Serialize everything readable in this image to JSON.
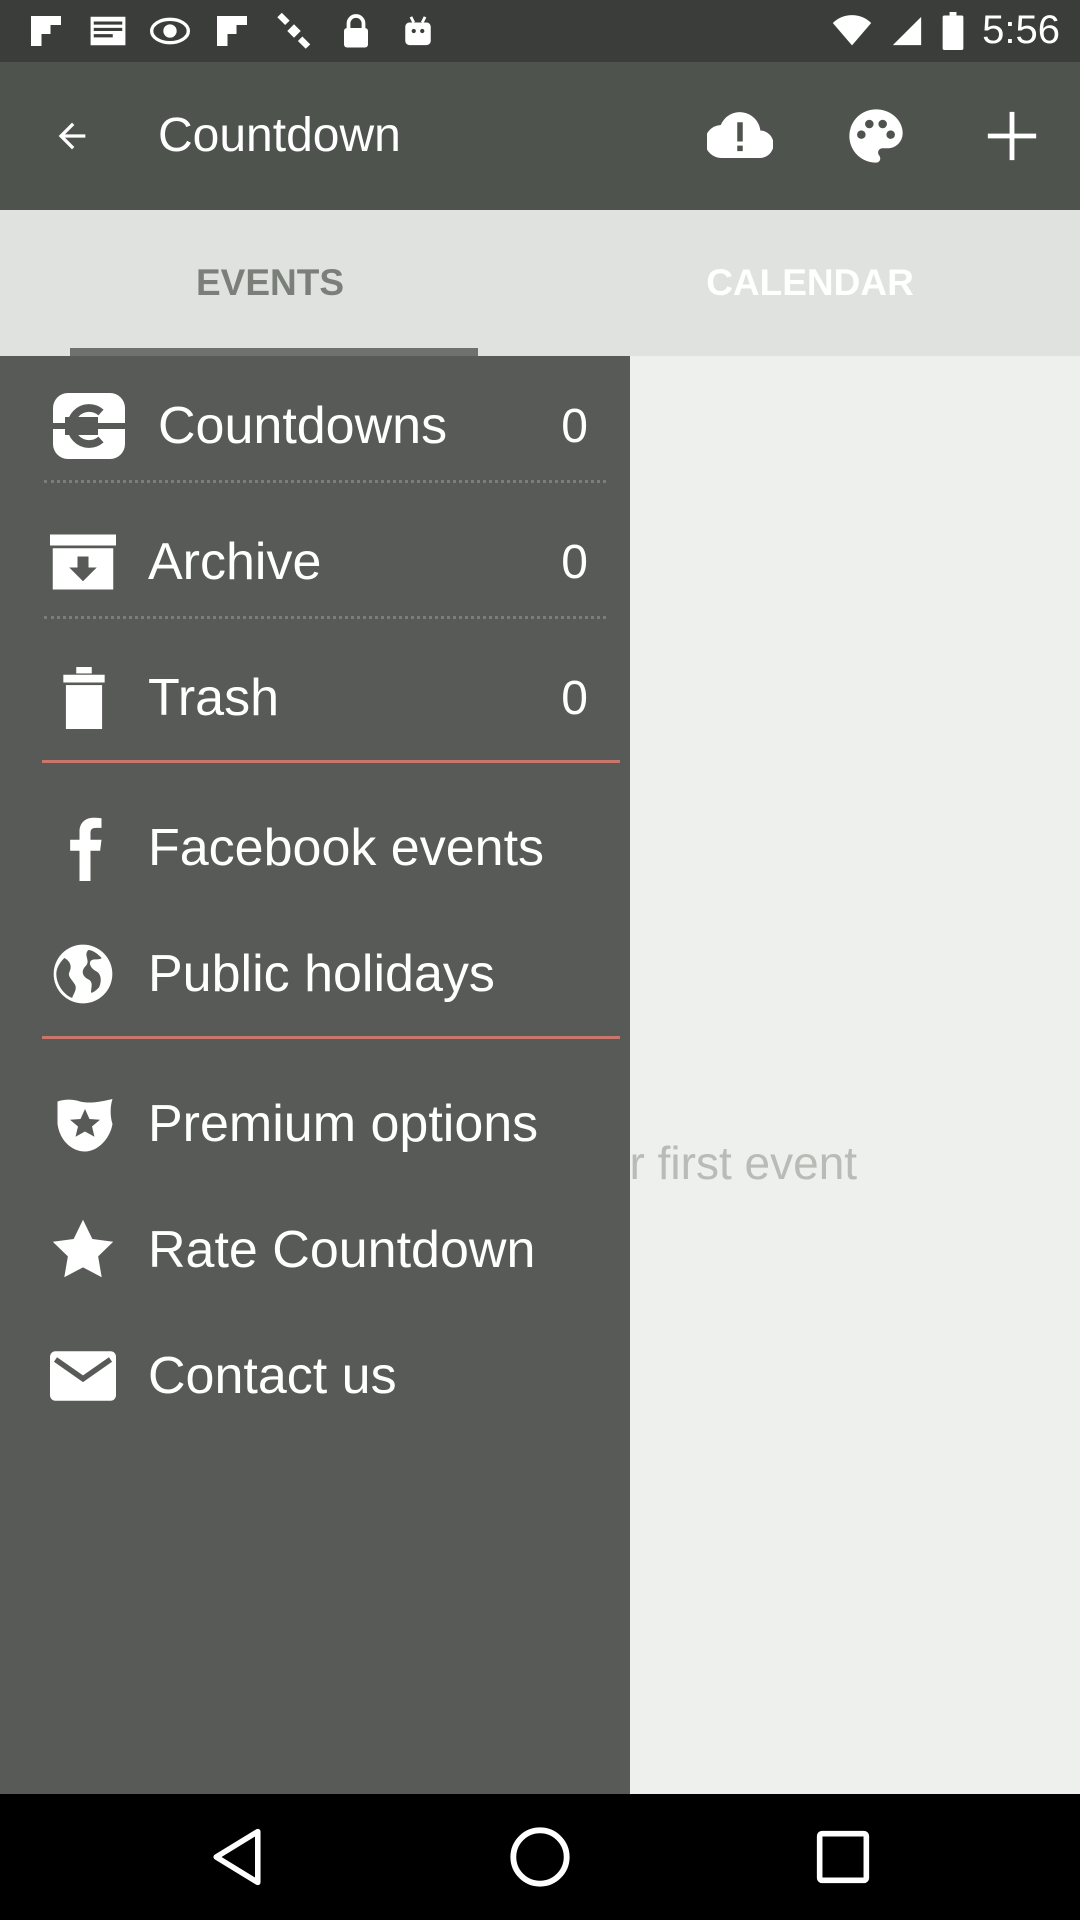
{
  "status_bar": {
    "time": "5:56",
    "notification_icons": [
      "flipboard-icon",
      "mail-icon",
      "eye-icon",
      "flipboard-icon",
      "satellite-icon",
      "lock-icon",
      "android-icon"
    ]
  },
  "toolbar": {
    "title": "Countdown"
  },
  "tabs": [
    {
      "label": "EVENTS"
    },
    {
      "label": "CALENDAR"
    }
  ],
  "content": {
    "empty_hint": "Tap here to add your first event"
  },
  "drawer": {
    "items": [
      {
        "label": "Countdowns",
        "count": "0",
        "icon": "countdown-icon"
      },
      {
        "label": "Archive",
        "count": "0",
        "icon": "archive-icon"
      },
      {
        "label": "Trash",
        "count": "0",
        "icon": "trash-icon"
      },
      {
        "label": "Facebook events",
        "icon": "facebook-icon"
      },
      {
        "label": "Public holidays",
        "icon": "globe-icon"
      },
      {
        "label": "Premium options",
        "icon": "premium-star-icon"
      },
      {
        "label": "Rate Countdown",
        "icon": "star-icon"
      },
      {
        "label": "Contact us",
        "icon": "mail-icon"
      }
    ]
  },
  "colors": {
    "toolbar": "#4f534e",
    "drawer": "#585a57",
    "divider": "#c9776a",
    "tab_bar": "#dfe2de"
  }
}
